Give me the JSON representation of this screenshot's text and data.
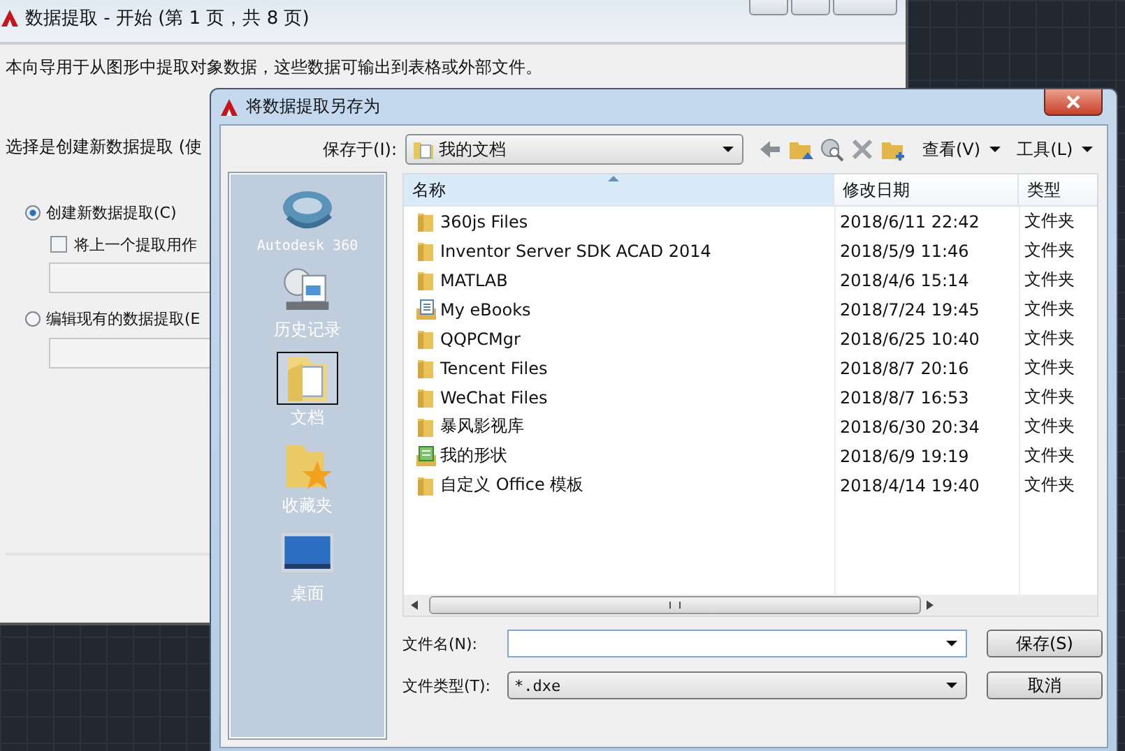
{
  "background_window": {
    "title": "数据提取 - 开始 (第 1 页，共 8 页)",
    "intro": "本向导用于从图形中提取对象数据，这些数据可输出到表格或外部文件。",
    "prompt": "选择是创建新数据提取 (使",
    "options": [
      {
        "label": "创建新数据提取(C)",
        "selected": true
      },
      {
        "label": "编辑现有的数据提取(E",
        "selected": false
      }
    ],
    "template_checkbox": {
      "label": "将上一个提取用作",
      "checked": false
    }
  },
  "dialog": {
    "title": "将数据提取另存为",
    "save_in_label": "保存于(I):",
    "save_in_value": "我的文档",
    "view_menu": "查看(V)",
    "tools_menu": "工具(L)",
    "places": [
      {
        "label": "Autodesk 360",
        "kind": "cloud",
        "selected": false
      },
      {
        "label": "历史记录",
        "kind": "history",
        "selected": false
      },
      {
        "label": "文档",
        "kind": "documents",
        "selected": true
      },
      {
        "label": "收藏夹",
        "kind": "favorites",
        "selected": false
      },
      {
        "label": "桌面",
        "kind": "desktop",
        "selected": false
      }
    ],
    "columns": [
      "名称",
      "修改日期",
      "类型"
    ],
    "files": [
      {
        "name": "360js Files",
        "modified": "2018/6/11 22:42",
        "type": "文件夹",
        "kind": "folder"
      },
      {
        "name": "Inventor Server SDK ACAD 2014",
        "modified": "2018/5/9 11:46",
        "type": "文件夹",
        "kind": "folder"
      },
      {
        "name": "MATLAB",
        "modified": "2018/4/6 15:14",
        "type": "文件夹",
        "kind": "folder"
      },
      {
        "name": "My eBooks",
        "modified": "2018/7/24 19:45",
        "type": "文件夹",
        "kind": "ebooks"
      },
      {
        "name": "QQPCMgr",
        "modified": "2018/6/25 10:40",
        "type": "文件夹",
        "kind": "folder"
      },
      {
        "name": "Tencent Files",
        "modified": "2018/8/7 20:16",
        "type": "文件夹",
        "kind": "folder"
      },
      {
        "name": "WeChat Files",
        "modified": "2018/8/7 16:53",
        "type": "文件夹",
        "kind": "folder"
      },
      {
        "name": "暴风影视库",
        "modified": "2018/6/30 20:34",
        "type": "文件夹",
        "kind": "folder"
      },
      {
        "name": "我的形状",
        "modified": "2018/6/9 19:19",
        "type": "文件夹",
        "kind": "shapes"
      },
      {
        "name": "自定义 Office 模板",
        "modified": "2018/4/14 19:40",
        "type": "文件夹",
        "kind": "folder"
      }
    ],
    "file_name_label": "文件名(N):",
    "file_type_label": "文件类型(T):",
    "file_type_value": "*.dxe",
    "buttons": [
      "保存(S)",
      "取消"
    ]
  }
}
